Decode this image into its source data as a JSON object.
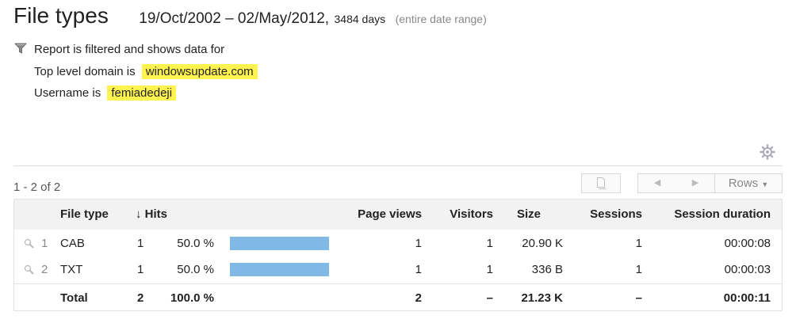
{
  "header": {
    "title": "File types",
    "date_range": "19/Oct/2002 – 02/May/2012,",
    "days": "3484 days",
    "range_note": "(entire date range)"
  },
  "filter": {
    "intro": "Report is filtered and shows data for",
    "conditions": [
      {
        "label": "Top level domain is",
        "value": "windowsupdate.com"
      },
      {
        "label": "Username is",
        "value": "femiadedeji"
      }
    ]
  },
  "pager": {
    "range_text": "1 - 2 of 2",
    "rows_label": "Rows",
    "prev_icon": "triangle-left",
    "next_icon": "triangle-right"
  },
  "table": {
    "columns": {
      "file_type": "File type",
      "sort_arrow": "↓",
      "hits": "Hits",
      "page_views": "Page views",
      "visitors": "Visitors",
      "size": "Size",
      "sessions": "Sessions",
      "session_duration": "Session duration"
    },
    "rows": [
      {
        "index": "1",
        "file_type": "CAB",
        "hits": "1",
        "hits_pct": "50.0 %",
        "hits_share": 0.5,
        "page_views": "1",
        "visitors": "1",
        "size": "20.90 K",
        "sessions": "1",
        "session_duration": "00:00:08"
      },
      {
        "index": "2",
        "file_type": "TXT",
        "hits": "1",
        "hits_pct": "50.0 %",
        "hits_share": 0.5,
        "page_views": "1",
        "visitors": "1",
        "size": "336 B",
        "sessions": "1",
        "session_duration": "00:00:03"
      }
    ],
    "total": {
      "label": "Total",
      "hits": "2",
      "hits_pct": "100.0 %",
      "page_views": "2",
      "visitors": "–",
      "size": "21.23 K",
      "sessions": "–",
      "session_duration": "00:00:11"
    }
  },
  "colors": {
    "highlight": "#fff34f",
    "bar": "#80b8e6",
    "header_bg": "#f2f2f2"
  }
}
